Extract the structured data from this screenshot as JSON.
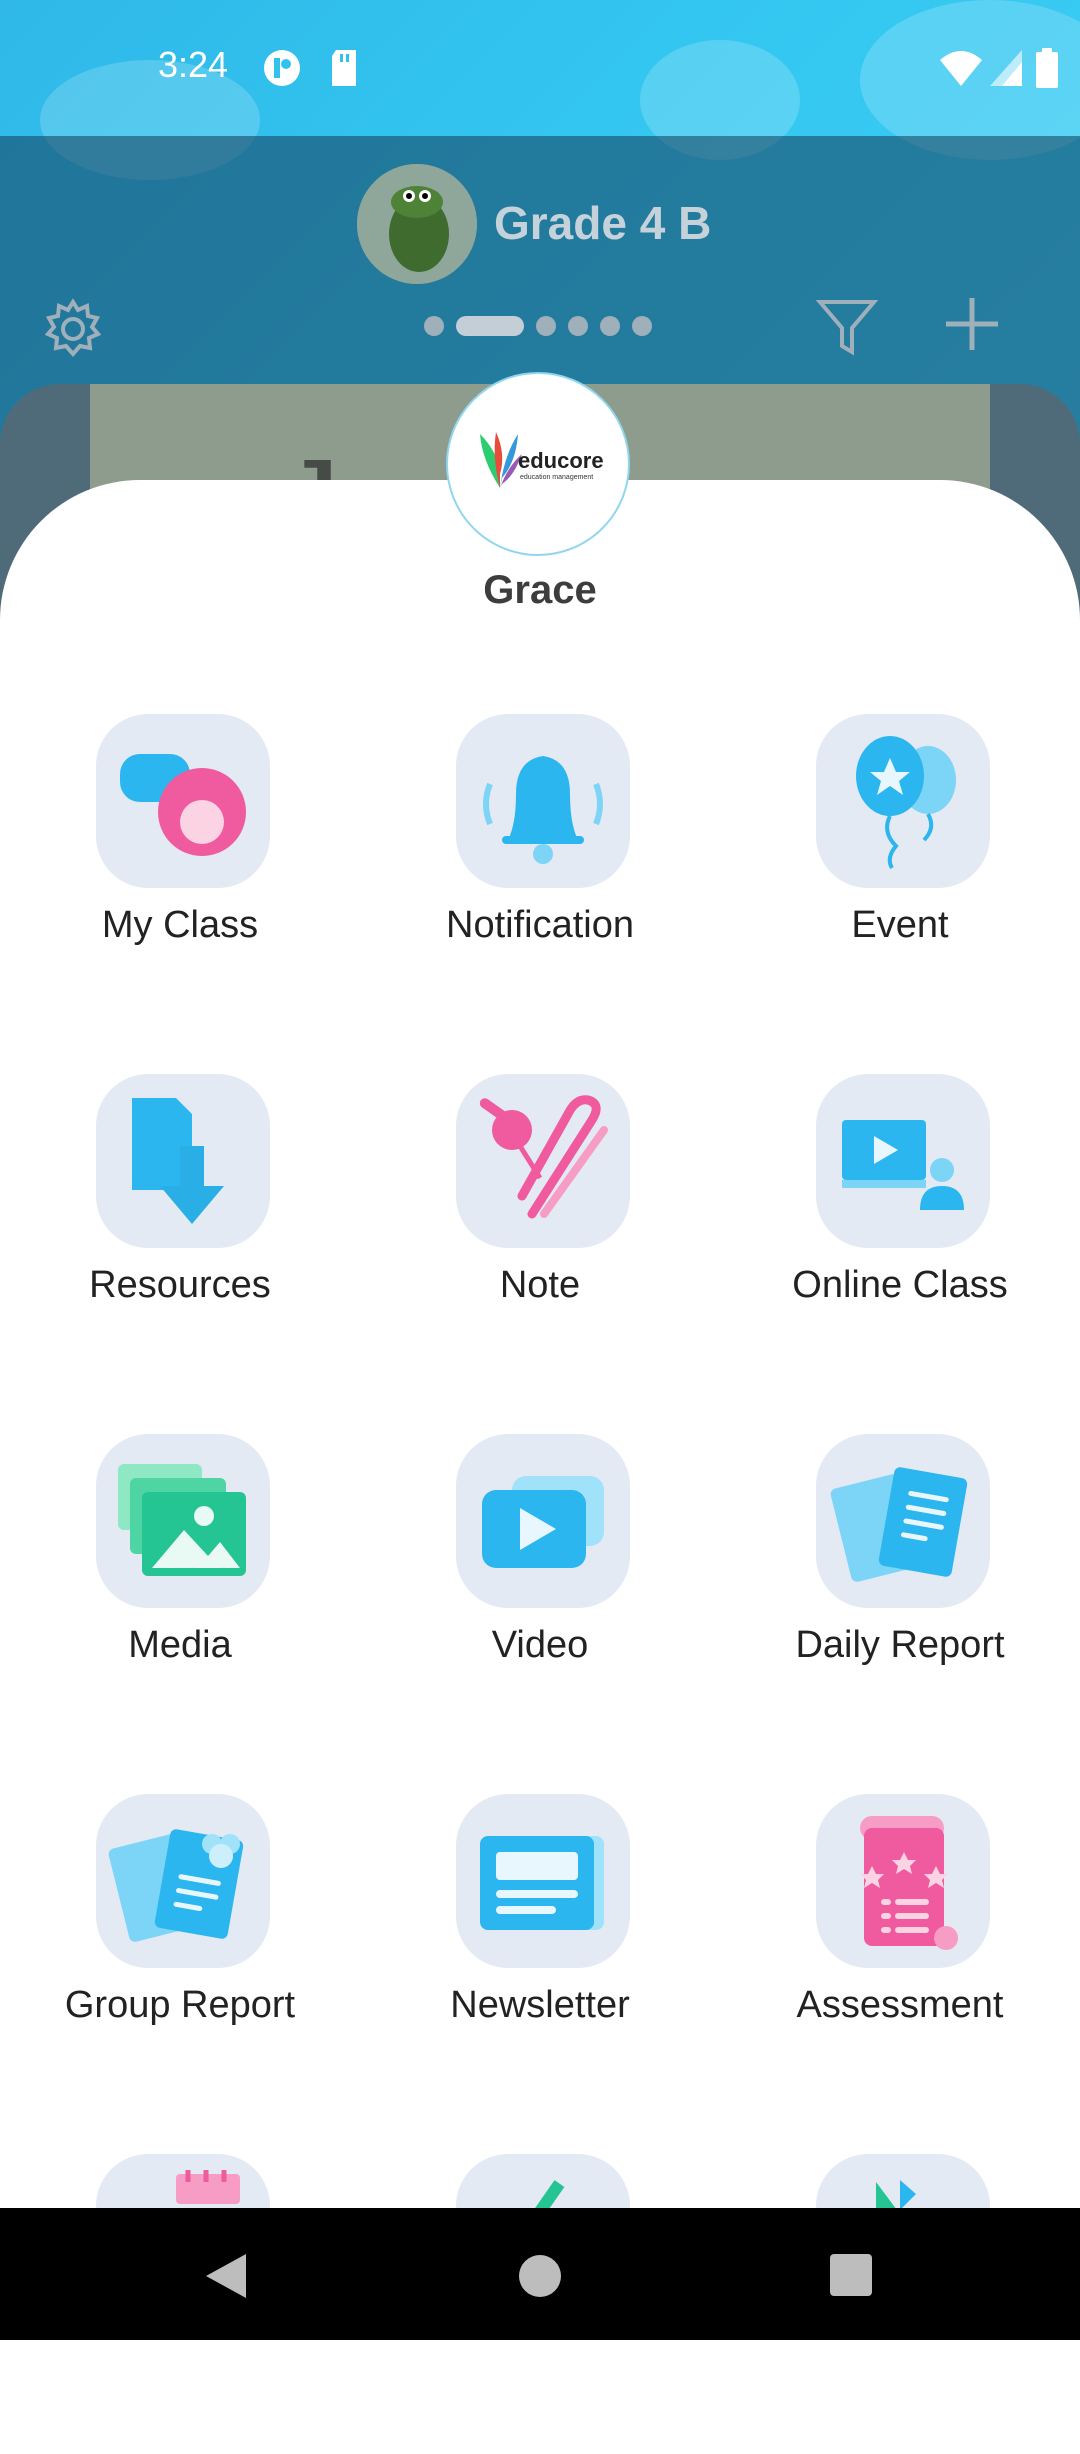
{
  "status_bar": {
    "time": "3:24"
  },
  "header": {
    "class_name": "Grade 4 B",
    "page_dots": 6,
    "active_dot": 1
  },
  "sheet": {
    "brand": "educore",
    "brand_subtitle": "education management",
    "user_name": "Grace",
    "menu": [
      {
        "label": "My Class",
        "icon": "chat-bubbles-icon"
      },
      {
        "label": "Notification",
        "icon": "bell-icon"
      },
      {
        "label": "Event",
        "icon": "balloons-icon"
      },
      {
        "label": "Resources",
        "icon": "file-download-icon"
      },
      {
        "label": "Note",
        "icon": "pin-clip-icon"
      },
      {
        "label": "Online Class",
        "icon": "video-presentation-icon"
      },
      {
        "label": "Media",
        "icon": "image-gallery-icon"
      },
      {
        "label": "Video",
        "icon": "play-video-icon"
      },
      {
        "label": "Daily Report",
        "icon": "report-document-icon"
      },
      {
        "label": "Group Report",
        "icon": "group-report-icon"
      },
      {
        "label": "Newsletter",
        "icon": "newsletter-icon"
      },
      {
        "label": "Assessment",
        "icon": "assessment-scroll-icon"
      },
      {
        "label": "",
        "icon": "calendar-icon"
      },
      {
        "label": "",
        "icon": "pencil-icon"
      },
      {
        "label": "",
        "icon": "chart-icon"
      }
    ]
  },
  "colors": {
    "accent_blue": "#2bb6ef",
    "accent_pink": "#f05a9e",
    "accent_green": "#24c493",
    "tile_bg": "#e3eaf4"
  }
}
